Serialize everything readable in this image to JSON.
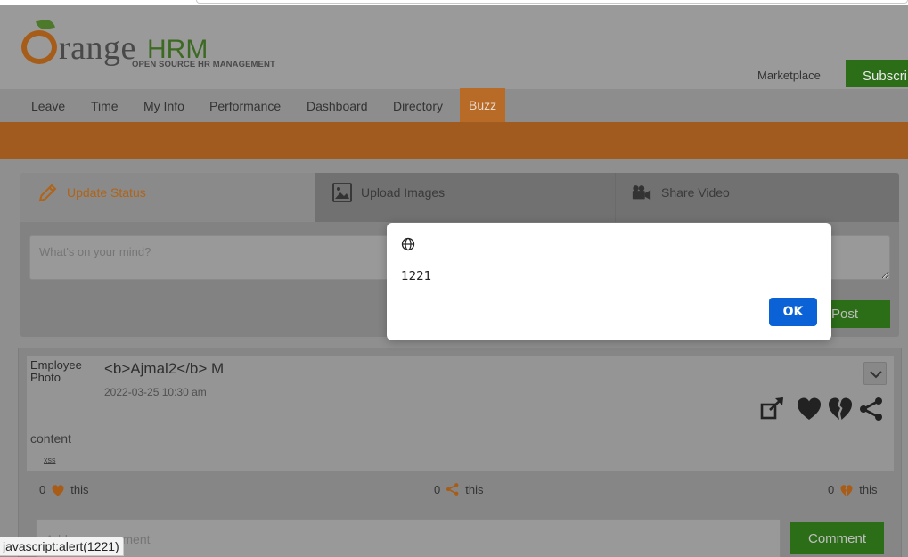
{
  "header": {
    "logo_word": "range",
    "logo_hrm": "HRM",
    "logo_tagline": "OPEN SOURCE HR MANAGEMENT",
    "marketplace": "Marketplace",
    "subscribe": "Subscri"
  },
  "nav": {
    "items": [
      "Leave",
      "Time",
      "My Info",
      "Performance",
      "Dashboard",
      "Directory",
      "Buzz"
    ],
    "active": "Buzz"
  },
  "post_panel": {
    "tabs": [
      {
        "label": "Update Status",
        "icon": "pencil-icon"
      },
      {
        "label": "Upload Images",
        "icon": "image-icon"
      },
      {
        "label": "Share Video",
        "icon": "video-camera-icon"
      }
    ],
    "placeholder": "What's on your mind?",
    "post_button": "Post"
  },
  "feed": {
    "photo_alt": "Employee Photo",
    "author": "<b>Ajmal2</b> M",
    "date": "2022-03-25",
    "time": "10:30 am",
    "content": "content",
    "link": "xss",
    "stats": {
      "likes": "0",
      "shares": "0",
      "unlikes": "0",
      "suffix": "this"
    },
    "comment_placeholder": "Add your comment",
    "comment_button": "Comment"
  },
  "status_bar": {
    "link": "javascript:alert(1221)"
  },
  "dialog": {
    "message": "1221",
    "ok": "OK"
  },
  "colors": {
    "accent_orange": "#f28c38",
    "brand_green": "#56ac35",
    "dialog_button": "#0b62d6"
  }
}
